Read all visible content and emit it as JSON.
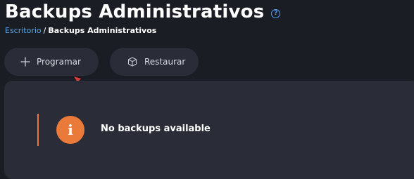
{
  "page": {
    "title": "Backups Administrativos"
  },
  "breadcrumb": {
    "home": "Escritorio",
    "separator": "/",
    "current": "Backups Administrativos"
  },
  "actions": {
    "schedule_label": "Programar",
    "restore_label": "Restaurar"
  },
  "empty_state": {
    "message": "No backups available",
    "info_glyph": "i"
  },
  "help_glyph": "?",
  "colors": {
    "background": "#1b1d24",
    "panel": "#2a2d37",
    "accent_orange": "#e97a3a",
    "link_blue": "#5aa7ee",
    "annotation_arrow": "#e03c3c"
  }
}
